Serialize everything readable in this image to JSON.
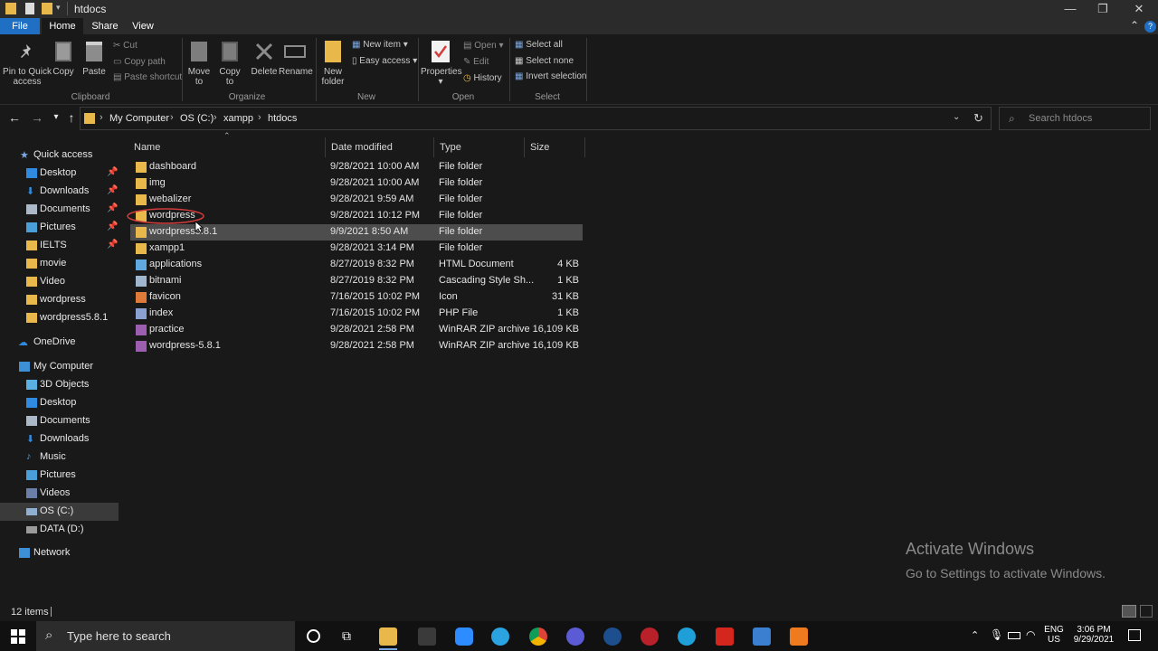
{
  "window": {
    "title": "htdocs",
    "min_glyph": "—",
    "max_glyph": "❐",
    "close_glyph": "✕"
  },
  "tabs": {
    "file": "File",
    "home": "Home",
    "share": "Share",
    "view": "View",
    "collapse_glyph": "⌃",
    "help_glyph": "?"
  },
  "ribbon": {
    "clipboard": {
      "pin_label_1": "Pin to Quick",
      "pin_label_2": "access",
      "copy": "Copy",
      "paste": "Paste",
      "cut": "Cut",
      "copy_path": "Copy path",
      "paste_shortcut": "Paste shortcut",
      "group": "Clipboard"
    },
    "organize": {
      "move_to_1": "Move",
      "move_to_2": "to",
      "copy_to_1": "Copy",
      "copy_to_2": "to",
      "delete": "Delete",
      "rename": "Rename",
      "group": "Organize"
    },
    "new": {
      "new_folder_1": "New",
      "new_folder_2": "folder",
      "new_item": "New item",
      "easy_access": "Easy access",
      "group": "New"
    },
    "open": {
      "properties": "Properties",
      "open": "Open",
      "edit": "Edit",
      "history": "History",
      "group": "Open"
    },
    "select": {
      "select_all": "Select all",
      "select_none": "Select none",
      "invert_selection": "Invert selection",
      "group": "Select"
    }
  },
  "address": {
    "crumbs": [
      "My Computer",
      "OS (C:)",
      "xampp",
      "htdocs"
    ],
    "search_placeholder": "Search htdocs"
  },
  "nav": {
    "quick_access": "Quick access",
    "quick_items": [
      "Desktop",
      "Downloads",
      "Documents",
      "Pictures",
      "IELTS",
      "movie",
      "Video",
      "wordpress",
      "wordpress5.8.1"
    ],
    "onedrive": "OneDrive",
    "my_computer": "My Computer",
    "pc_items": [
      "3D Objects",
      "Desktop",
      "Documents",
      "Downloads",
      "Music",
      "Pictures",
      "Videos",
      "OS (C:)",
      "DATA (D:)"
    ],
    "network": "Network"
  },
  "columns": {
    "name": "Name",
    "date": "Date modified",
    "type": "Type",
    "size": "Size"
  },
  "files": [
    {
      "name": "dashboard",
      "date": "9/28/2021 10:00 AM",
      "type": "File folder",
      "size": "",
      "icon": "folder-icon"
    },
    {
      "name": "img",
      "date": "9/28/2021 10:00 AM",
      "type": "File folder",
      "size": "",
      "icon": "folder-icon"
    },
    {
      "name": "webalizer",
      "date": "9/28/2021 9:59 AM",
      "type": "File folder",
      "size": "",
      "icon": "folder-icon"
    },
    {
      "name": "wordpress",
      "date": "9/28/2021 10:12 PM",
      "type": "File folder",
      "size": "",
      "icon": "folder-icon"
    },
    {
      "name": "wordpress5.8.1",
      "date": "9/9/2021 8:50 AM",
      "type": "File folder",
      "size": "",
      "icon": "folder-icon"
    },
    {
      "name": "xampp1",
      "date": "9/28/2021 3:14 PM",
      "type": "File folder",
      "size": "",
      "icon": "folder-icon"
    },
    {
      "name": "applications",
      "date": "8/27/2019 8:32 PM",
      "type": "HTML Document",
      "size": "4 KB",
      "icon": "html-file-icon"
    },
    {
      "name": "bitnami",
      "date": "8/27/2019 8:32 PM",
      "type": "Cascading Style Sh...",
      "size": "1 KB",
      "icon": "css-file-icon"
    },
    {
      "name": "favicon",
      "date": "7/16/2015 10:02 PM",
      "type": "Icon",
      "size": "31 KB",
      "icon": "ico-file-icon"
    },
    {
      "name": "index",
      "date": "7/16/2015 10:02 PM",
      "type": "PHP File",
      "size": "1 KB",
      "icon": "php-file-icon"
    },
    {
      "name": "practice",
      "date": "9/28/2021 2:58 PM",
      "type": "WinRAR ZIP archive",
      "size": "16,109 KB",
      "icon": "zip-file-icon"
    },
    {
      "name": "wordpress-5.8.1",
      "date": "9/28/2021 2:58 PM",
      "type": "WinRAR ZIP archive",
      "size": "16,109 KB",
      "icon": "zip-file-icon"
    }
  ],
  "watermark": {
    "line1": "Activate Windows",
    "line2": "Go to Settings to activate Windows."
  },
  "status": {
    "items": "12 items"
  },
  "taskbar": {
    "search_placeholder": "Type here to search",
    "lang_1": "ENG",
    "lang_2": "US",
    "time": "3:06 PM",
    "date": "9/29/2021"
  },
  "colors": {
    "accent": "#1f6fc5",
    "folder": "#e8b84a",
    "selection": "#4d4d4d",
    "annotation_circle": "#d23c3c"
  }
}
